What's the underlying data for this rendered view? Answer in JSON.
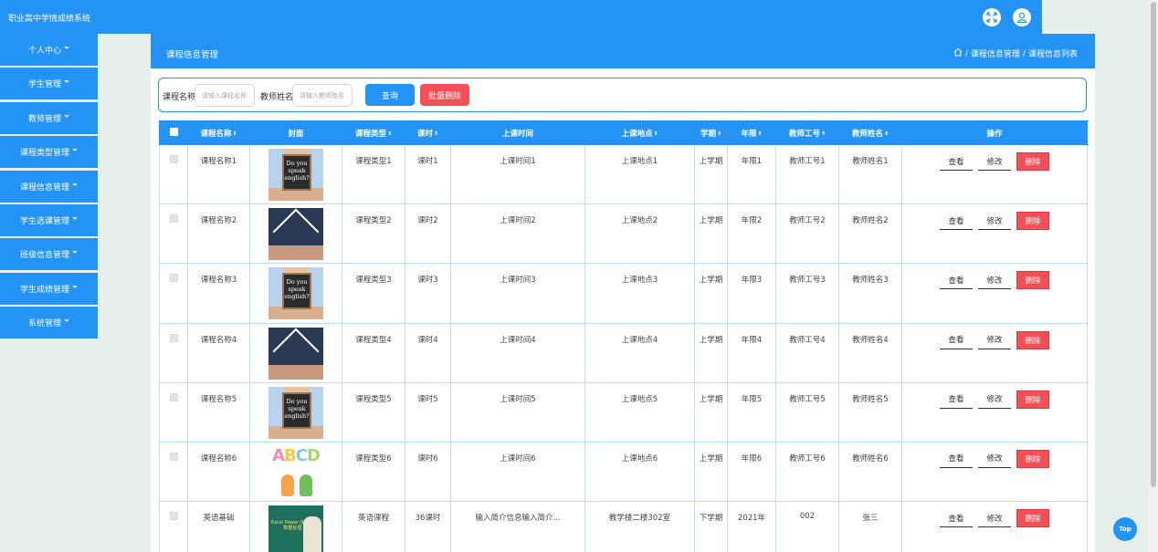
{
  "app": {
    "title": "职业高中学情成绩系统"
  },
  "header_icons": {
    "fullscreen": "fullscreen-icon",
    "user": "user-icon"
  },
  "sidebar": {
    "items": [
      {
        "label": "个人中心"
      },
      {
        "label": "学生管理"
      },
      {
        "label": "教师管理"
      },
      {
        "label": "课程类型管理"
      },
      {
        "label": "课程信息管理"
      },
      {
        "label": "学生选课管理"
      },
      {
        "label": "班级信息管理"
      },
      {
        "label": "学生成绩管理"
      },
      {
        "label": "系统管理"
      }
    ]
  },
  "page": {
    "title": "课程信息管理",
    "breadcrumb": [
      "课程信息管理",
      "课程信息列表"
    ],
    "breadcrumb_sep": "/"
  },
  "search": {
    "course_label": "课程名称",
    "course_placeholder": "请输入课程名称",
    "teacher_label": "教师姓名",
    "teacher_placeholder": "请输入教师姓名",
    "query_label": "查询",
    "batch_delete_label": "批量删除"
  },
  "table": {
    "headers": [
      "课程名称",
      "封面",
      "课程类型",
      "课时",
      "上课时间",
      "上课地点",
      "学期",
      "年限",
      "教师工号",
      "教师姓名",
      "操作"
    ],
    "sort_mark": "⇕",
    "rows": [
      {
        "name": "课程名称1",
        "cover": "speak-english",
        "type": "课程类型1",
        "hours": "课时1",
        "time": "上课时间1",
        "place": "上课地点1",
        "term": "上学期",
        "year": "年限1",
        "tid": "教师工号1",
        "tname": "教师姓名1"
      },
      {
        "name": "课程名称2",
        "cover": "book-roof",
        "type": "课程类型2",
        "hours": "课时2",
        "time": "上课时间2",
        "place": "上课地点2",
        "term": "上学期",
        "year": "年限2",
        "tid": "教师工号2",
        "tname": "教师姓名2"
      },
      {
        "name": "课程名称3",
        "cover": "speak-english",
        "type": "课程类型3",
        "hours": "课时3",
        "time": "上课时间3",
        "place": "上课地点3",
        "term": "上学期",
        "year": "年限3",
        "tid": "教师工号3",
        "tname": "教师姓名3"
      },
      {
        "name": "课程名称4",
        "cover": "book-roof",
        "type": "课程类型4",
        "hours": "课时4",
        "time": "上课时间4",
        "place": "上课地点4",
        "term": "上学期",
        "year": "年限4",
        "tid": "教师工号4",
        "tname": "教师姓名4"
      },
      {
        "name": "课程名称5",
        "cover": "speak-english",
        "type": "课程类型5",
        "hours": "课时5",
        "time": "上课时间5",
        "place": "上课地点5",
        "term": "上学期",
        "year": "年限5",
        "tid": "教师工号5",
        "tname": "教师姓名5"
      },
      {
        "name": "课程名称6",
        "cover": "abcd-kids",
        "type": "课程类型6",
        "hours": "课时6",
        "time": "上课时间6",
        "place": "上课地点6",
        "term": "上学期",
        "year": "年限6",
        "tid": "教师工号6",
        "tname": "教师姓名6"
      },
      {
        "name": "英语基础",
        "cover": "excel-book",
        "type": "英语课程",
        "hours": "36课时",
        "time": "输入简介信息输入简介...",
        "place": "教学楼二楼302室",
        "term": "下学期",
        "year": "2021年",
        "tid": "002",
        "tname": "张三"
      }
    ],
    "actions": {
      "view": "查看",
      "edit": "修改",
      "delete": "删除"
    }
  },
  "cover_text": {
    "speak": [
      "Do you",
      "speak",
      "english?"
    ],
    "abc": [
      "A",
      "B",
      "C",
      "D"
    ],
    "excel": [
      "Excel Power Query",
      "数据处理"
    ]
  },
  "top_button": "Top",
  "colors": {
    "primary": "#2393f5",
    "danger": "#f44e56",
    "background": "#e6efeb"
  }
}
